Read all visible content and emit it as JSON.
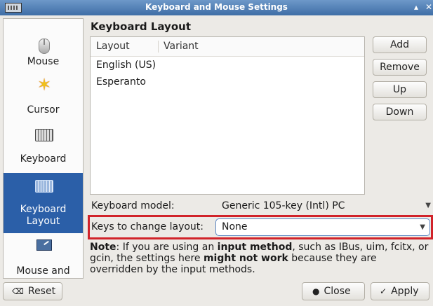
{
  "window": {
    "title": "Keyboard and Mouse Settings",
    "controls": [
      "▴",
      "✕"
    ]
  },
  "sidebar": {
    "items": [
      {
        "label": "Mouse",
        "icon": "mouse-icon"
      },
      {
        "label": "Cursor",
        "icon": "cursor-icon"
      },
      {
        "label": "Keyboard",
        "icon": "keyboard-icon"
      },
      {
        "label": "Keyboard Layout",
        "label_line1": "Keyboard",
        "label_line2": "Layout",
        "icon": "keyboard-layout-icon",
        "selected": true
      },
      {
        "label": "Mouse and",
        "icon": "mouse-and-keyboard-icon"
      }
    ]
  },
  "main": {
    "heading": "Keyboard Layout",
    "layout_list": {
      "columns": [
        "Layout",
        "Variant"
      ],
      "rows": [
        {
          "layout": "English (US)",
          "variant": ""
        },
        {
          "layout": "Esperanto",
          "variant": ""
        }
      ]
    },
    "buttons": {
      "add": "Add",
      "remove": "Remove",
      "up": "Up",
      "down": "Down"
    },
    "keyboard_model": {
      "label": "Keyboard model:",
      "value": "Generic 105-key (Intl) PC"
    },
    "change_layout": {
      "label": "Keys to change layout:",
      "value": "None"
    },
    "note": {
      "label": "Note",
      "t1": ": If you are using an ",
      "b1": "input method",
      "t2": ", such as IBus, uim, fcitx, or gcin, the settings here ",
      "b2": "might not work",
      "t3": " because they are overridden by the input methods."
    },
    "highlight_color": "#d1232a"
  },
  "footer": {
    "reset": "Reset",
    "close": "Close",
    "apply": "Apply"
  },
  "colors": {
    "titlebar": "#4f7fb8",
    "selection": "#2b5fa8"
  }
}
